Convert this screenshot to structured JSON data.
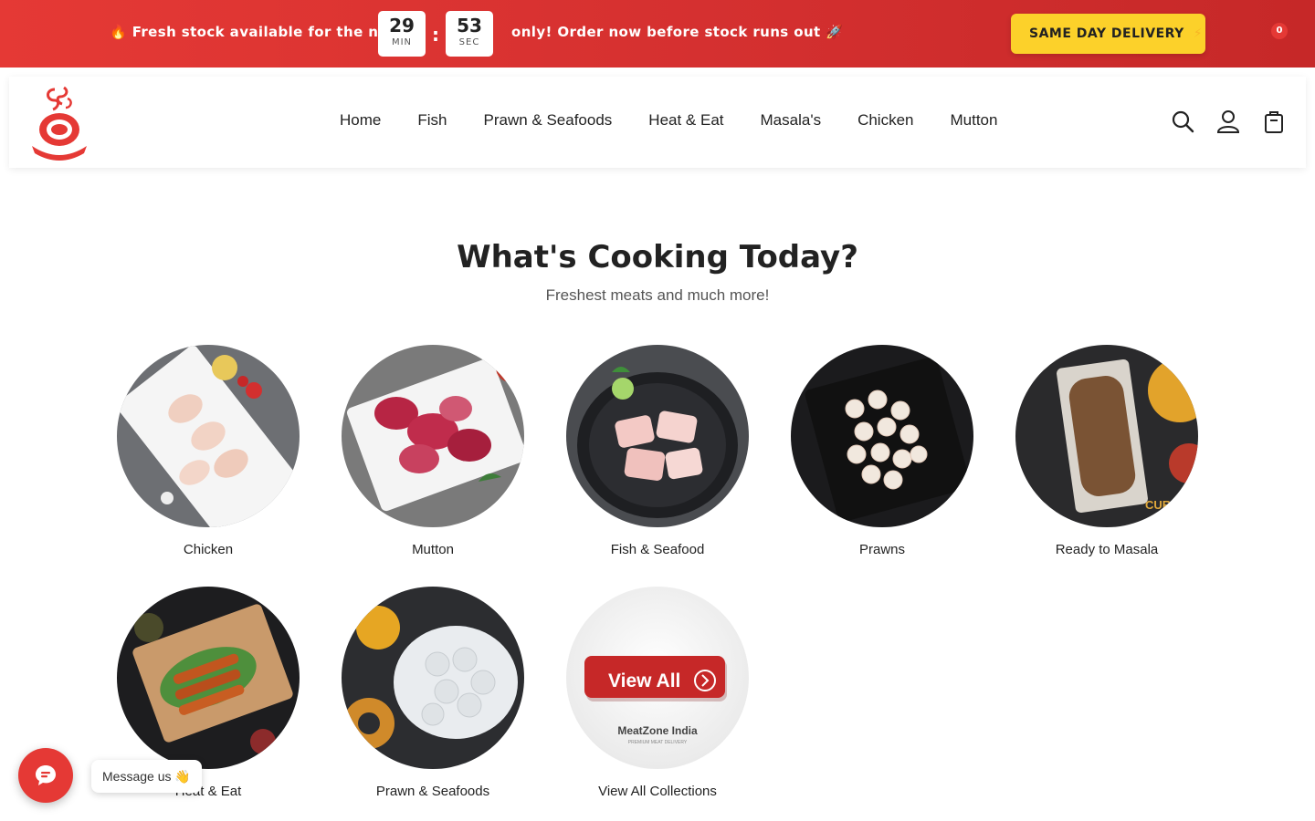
{
  "announcement": {
    "left_text": "🔥 Fresh stock available for the next",
    "timer": {
      "minutes": "29",
      "minutes_unit": "MIN",
      "separator": ":",
      "seconds": "53",
      "seconds_unit": "SEC"
    },
    "right_text": "only! Order now before stock runs out 🚀",
    "cta_label": "SAME DAY DELIVERY",
    "cta_icon": "⚡"
  },
  "header": {
    "logo_icon": "meatzone-logo-icon",
    "nav": [
      "Home",
      "Fish",
      "Prawn & Seafoods",
      "Heat & Eat",
      "Masala's",
      "Chicken",
      "Mutton"
    ],
    "icons": [
      "search-icon",
      "user-icon",
      "cart-icon"
    ],
    "cart_count": "0"
  },
  "section": {
    "title": "What's Cooking Today?",
    "subtitle": "Freshest meats and much more!",
    "categories": [
      {
        "label": "Chicken"
      },
      {
        "label": "Mutton"
      },
      {
        "label": "Fish & Seafood"
      },
      {
        "label": "Prawns"
      },
      {
        "label": "Ready to Masala"
      },
      {
        "label": "Heat & Eat"
      },
      {
        "label": "Prawn & Seafoods"
      },
      {
        "label": "View All Collections",
        "tile_button": "View All",
        "tile_brand": "MeatZone India",
        "tile_tagline": "PREMIUM MEAT DELIVERY"
      }
    ],
    "masala_pack_text": "CURRY MASALA"
  },
  "chat": {
    "icon": "chat-icon",
    "label": "Message us 👋"
  },
  "colors": {
    "brand_red": "#e53935",
    "cta_yellow": "#fcd12a"
  }
}
